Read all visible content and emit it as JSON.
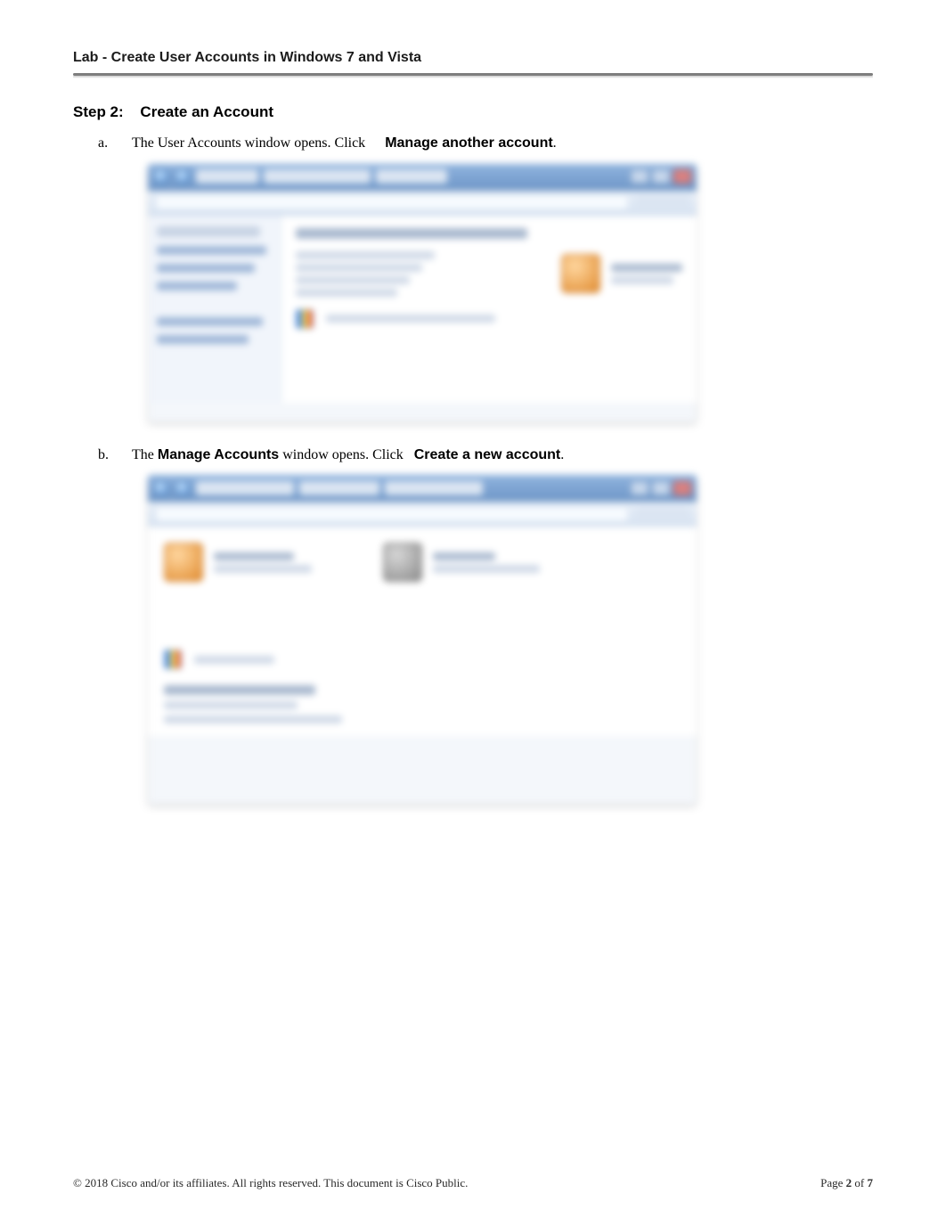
{
  "header": {
    "running_title": "Lab - Create User Accounts in Windows 7 and Vista"
  },
  "step": {
    "label": "Step 2:",
    "title": "Create an Account"
  },
  "items": {
    "a": {
      "marker": "a.",
      "pre": "The User Accounts window opens. Click",
      "bold": "Manage another account",
      "post": "."
    },
    "b": {
      "marker": "b.",
      "pre": "The ",
      "bold1": "Manage Accounts",
      "mid": " window opens. Click ",
      "bold2": "Create a new account",
      "post": "."
    }
  },
  "footer": {
    "copyright": "© 2018 Cisco and/or its affiliates. All rights reserved. This document is Cisco Public.",
    "page_label": "Page ",
    "current": "2",
    "of": " of ",
    "total": "7"
  }
}
